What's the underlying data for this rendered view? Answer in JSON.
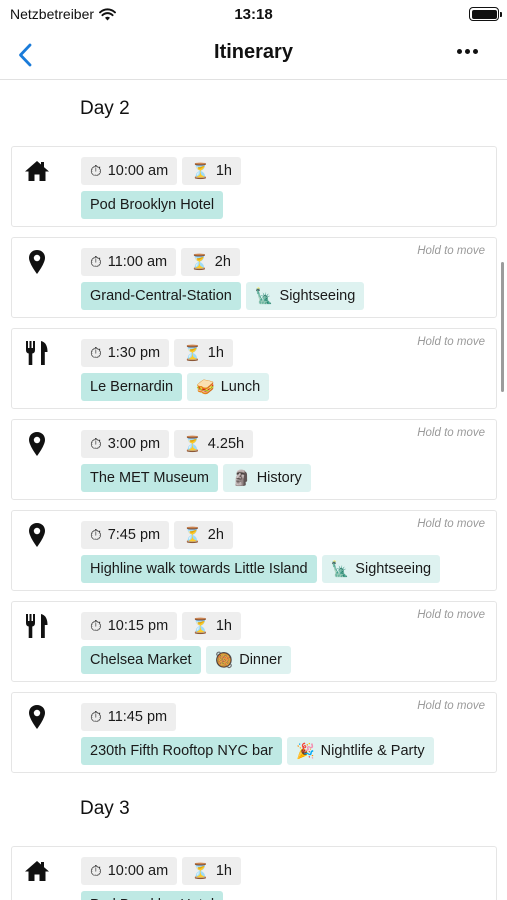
{
  "status": {
    "carrier": "Netzbetreiber",
    "time": "13:18"
  },
  "nav": {
    "title": "Itinerary"
  },
  "icons": {
    "home": "home-icon",
    "location": "location-pin-icon",
    "restaurant": "fork-knife-icon",
    "time": "stopwatch-icon",
    "duration": "hourglass-icon"
  },
  "colors": {
    "accent": "#1a7bd9",
    "location_chip": "#bfe9e4",
    "category_chip": "#def2f0",
    "time_chip": "#eeeeee"
  },
  "days": [
    {
      "label": "Day 2",
      "items": [
        {
          "type": "home",
          "time": "10:00 am",
          "duration": "1h",
          "place": "Pod Brooklyn Hotel",
          "category": "",
          "category_emoji": "",
          "hold": ""
        },
        {
          "type": "location",
          "time": "11:00 am",
          "duration": "2h",
          "place": "Grand-Central-Station",
          "category": "Sightseeing",
          "category_emoji": "🗽",
          "hold": "Hold to move"
        },
        {
          "type": "restaurant",
          "time": "1:30 pm",
          "duration": "1h",
          "place": "Le Bernardin",
          "category": "Lunch",
          "category_emoji": "🥪",
          "hold": "Hold to move"
        },
        {
          "type": "location",
          "time": "3:00 pm",
          "duration": "4.25h",
          "place": "The MET Museum",
          "category": "History",
          "category_emoji": "🗿",
          "hold": "Hold to move"
        },
        {
          "type": "location",
          "time": "7:45 pm",
          "duration": "2h",
          "place": "Highline walk towards Little Island",
          "category": "Sightseeing",
          "category_emoji": "🗽",
          "hold": "Hold to move"
        },
        {
          "type": "restaurant",
          "time": "10:15 pm",
          "duration": "1h",
          "place": "Chelsea Market",
          "category": "Dinner",
          "category_emoji": "🥘",
          "hold": "Hold to move"
        },
        {
          "type": "location",
          "time": "11:45 pm",
          "duration": "",
          "place": "230th Fifth Rooftop NYC bar",
          "category": "Nightlife & Party",
          "category_emoji": "🎉",
          "hold": "Hold to move"
        }
      ]
    },
    {
      "label": "Day 3",
      "items": [
        {
          "type": "home",
          "time": "10:00 am",
          "duration": "1h",
          "place": "Pod Brooklyn Hotel",
          "category": "",
          "category_emoji": "",
          "hold": ""
        }
      ]
    }
  ]
}
